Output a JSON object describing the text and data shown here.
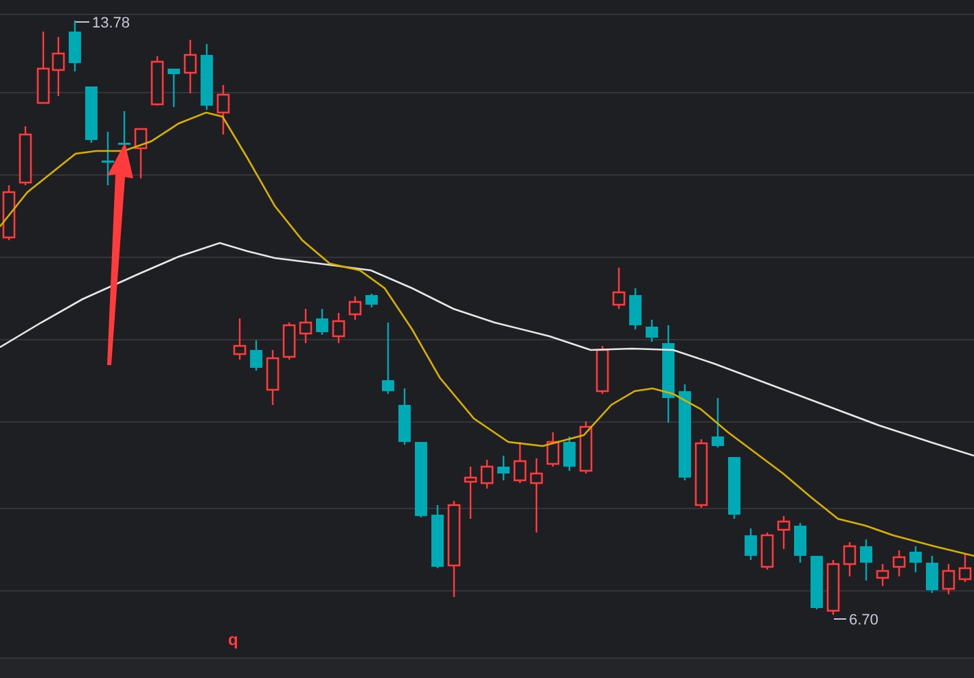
{
  "chart": {
    "high_label": {
      "text": "13.78"
    },
    "low_label": {
      "text": "6.70"
    },
    "marker": {
      "text": "q"
    }
  }
}
